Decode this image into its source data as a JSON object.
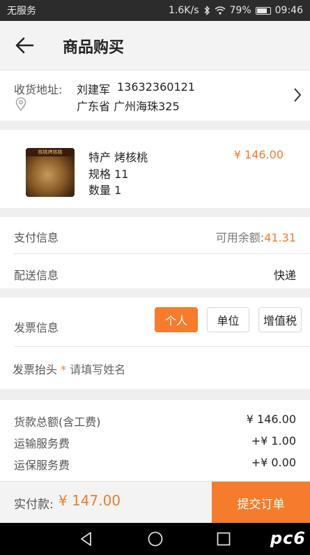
{
  "status_bar": {
    "carrier": "无服务",
    "speed": "1.6K/s",
    "battery": "79%",
    "time": "09:46"
  },
  "header": {
    "title": "商品购买"
  },
  "address": {
    "label": "收货地址:",
    "name": "刘建军",
    "phone": "13632360121",
    "line": "广东省  广州海珠325"
  },
  "product": {
    "name": "特产 烤核桃",
    "spec": "规格 11",
    "quantity": "数量 1",
    "price": "¥ 146.00",
    "image_text": "核桃烤核桃"
  },
  "payment": {
    "label": "支付信息",
    "balance_label": "可用余额:",
    "balance_value": "41.31"
  },
  "delivery": {
    "label": "配送信息",
    "value": "快递"
  },
  "invoice": {
    "label": "发票信息",
    "options": [
      "个人",
      "单位",
      "增值税"
    ],
    "selected": "个人",
    "title_label": "发票抬头",
    "required_mark": "*",
    "title_placeholder": "请填写姓名"
  },
  "fees": [
    {
      "label": "货款总额(含工费)",
      "value": "¥ 146.00"
    },
    {
      "label": "运输服务费",
      "value": "+¥ 1.00"
    },
    {
      "label": "运保服务费",
      "value": "+¥ 0.00"
    }
  ],
  "footer": {
    "pay_label": "实付款:",
    "pay_amount": "¥ 147.00",
    "submit_label": "提交订单"
  },
  "watermark": "pc6",
  "colors": {
    "accent": "#f47c2c",
    "status_bar": "#2c2c2c",
    "nav_bar": "#000000",
    "background": "#efefef"
  },
  "icons": [
    "wifi-icon",
    "bluetooth-icon",
    "battery-icon",
    "back-arrow-icon",
    "location-pin-icon",
    "chevron-right-icon",
    "nav-back-icon",
    "nav-home-icon",
    "nav-recents-icon"
  ]
}
